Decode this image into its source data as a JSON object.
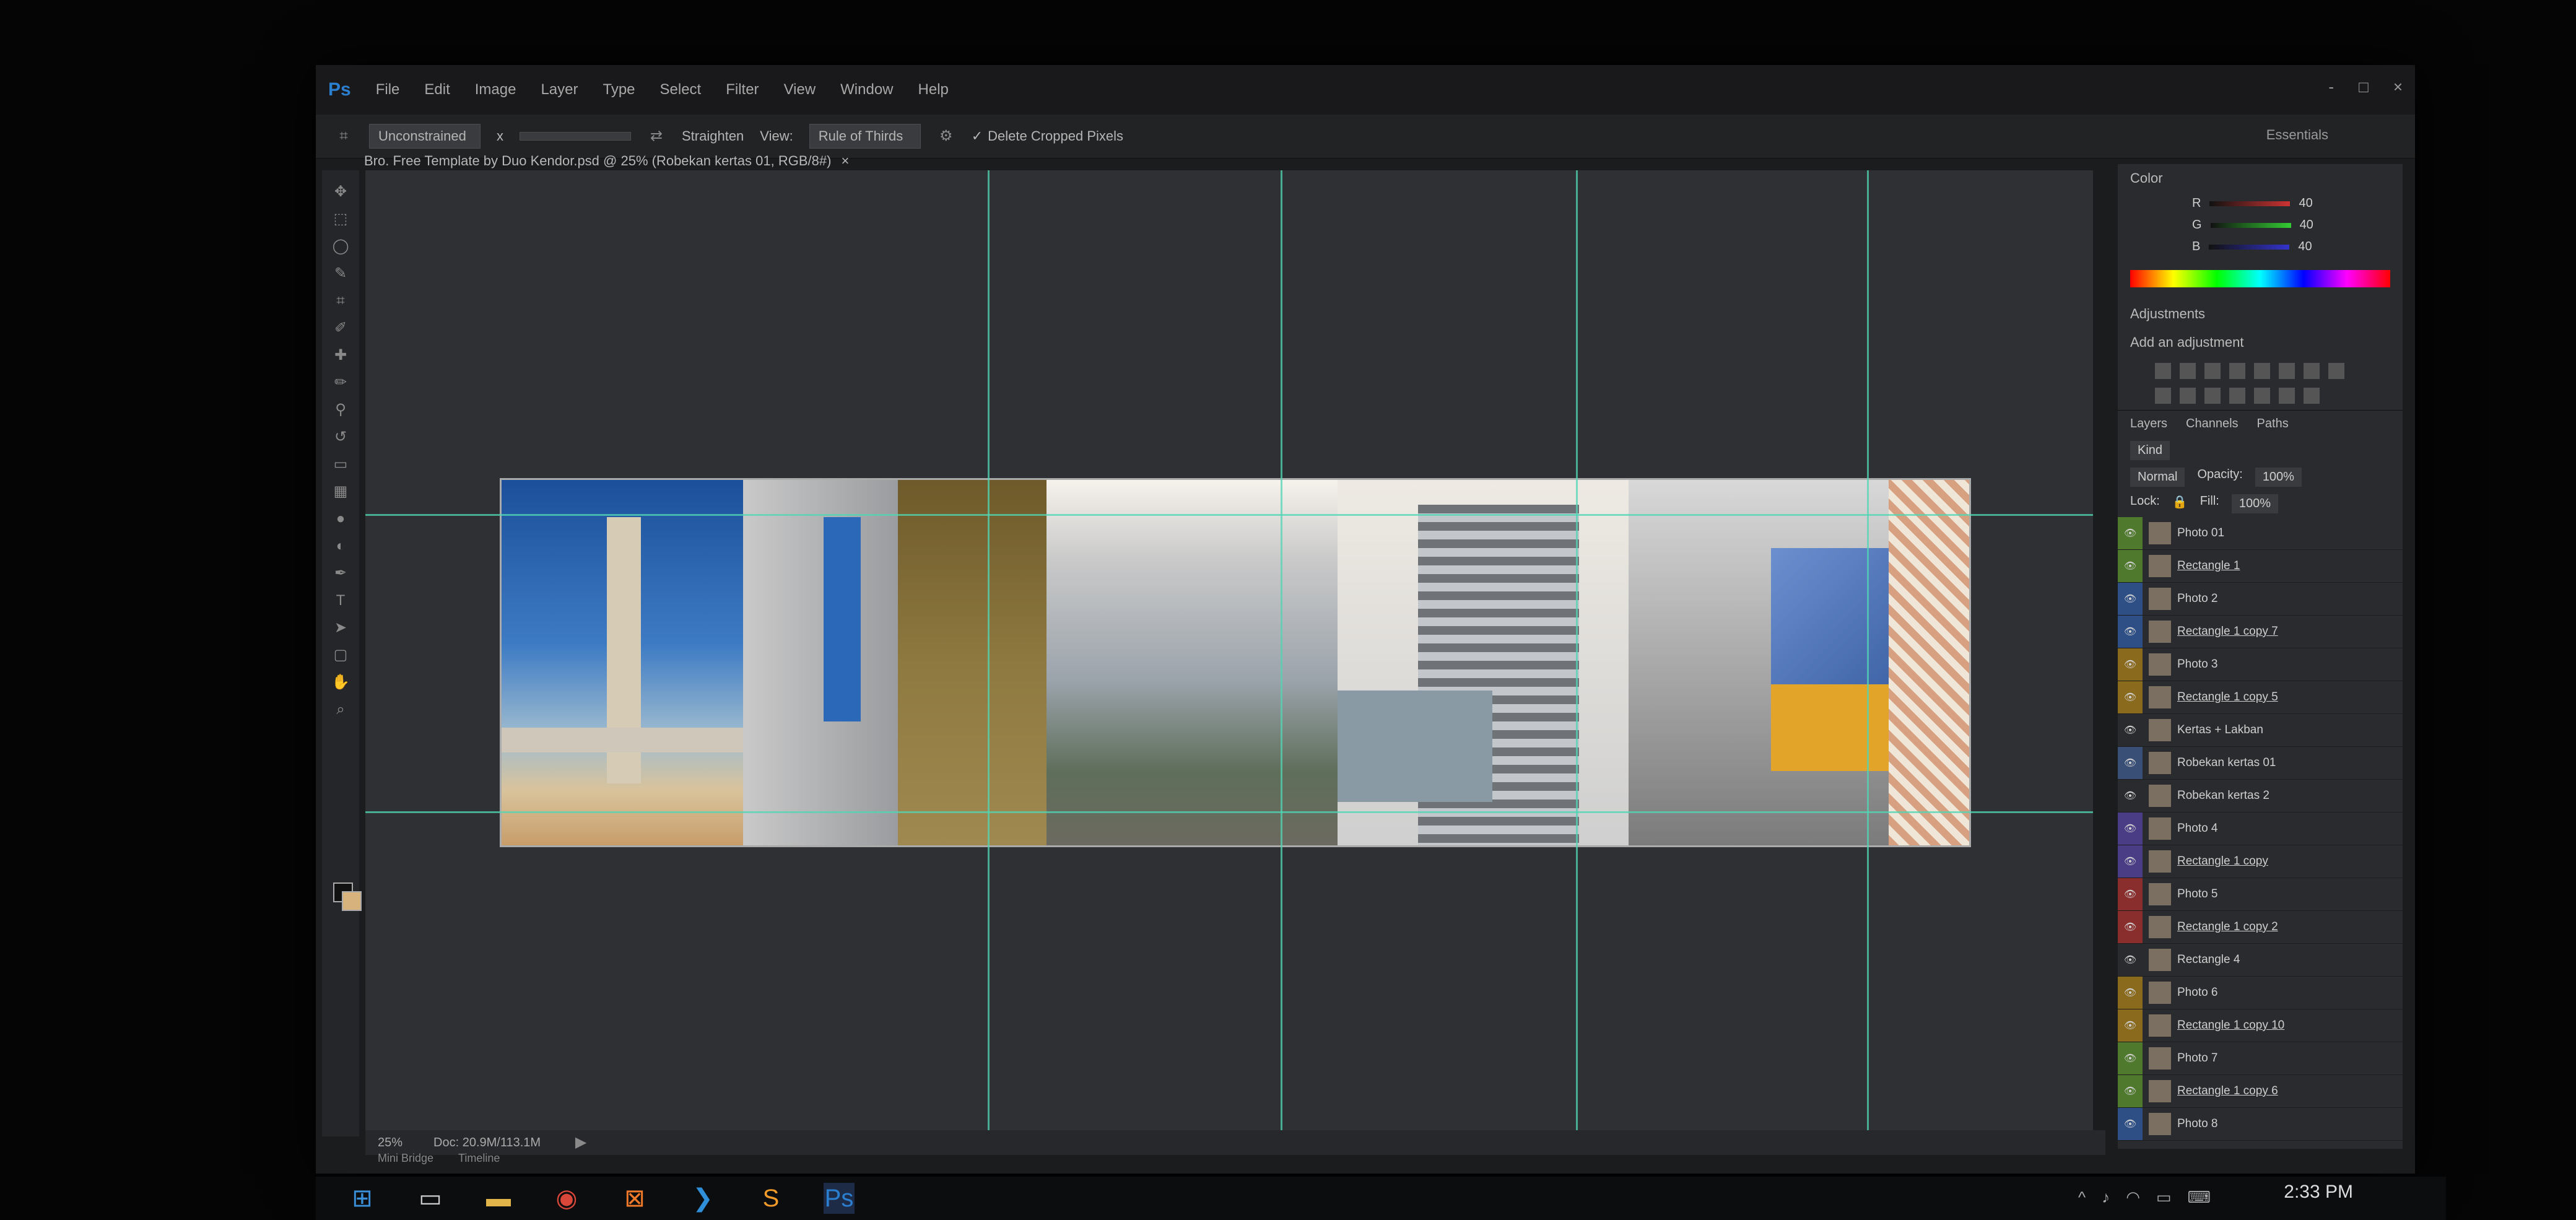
{
  "app": {
    "name": "Ps"
  },
  "menu": [
    "File",
    "Edit",
    "Image",
    "Layer",
    "Type",
    "Select",
    "Filter",
    "View",
    "Window",
    "Help"
  ],
  "window_controls": {
    "minimize": "-",
    "maximize": "□",
    "close": "×"
  },
  "options_bar": {
    "ratio": "Unconstrained",
    "ratio_sep": "x",
    "straighten": "Straighten",
    "view_label": "View:",
    "overlay": "Rule of Thirds",
    "delete_cropped": "Delete Cropped Pixels"
  },
  "workspace": "Essentials",
  "document": {
    "tab_title": "Bro. Free Template by Duo Kendor.psd @ 25% (Robekan kertas 01, RGB/8#)",
    "close": "×"
  },
  "status_bar": {
    "zoom": "25%",
    "doc_size": "Doc: 20.9M/113.1M"
  },
  "bottom_tabs": [
    "Mini Bridge",
    "Timeline"
  ],
  "color_panel": {
    "title": "Color",
    "rows": [
      {
        "channel": "R",
        "value": "40"
      },
      {
        "channel": "G",
        "value": "40"
      },
      {
        "channel": "B",
        "value": "40"
      }
    ]
  },
  "adjustments": {
    "title": "Adjustments",
    "subtitle": "Add an adjustment"
  },
  "layers_panel": {
    "tabs": [
      "Layers",
      "Channels",
      "Paths"
    ],
    "kind": "Kind",
    "blend_mode": "Normal",
    "opacity_label": "Opacity:",
    "opacity": "100%",
    "lock_label": "Lock:",
    "fill_label": "Fill:",
    "fill": "100%",
    "layers": [
      {
        "name": "Photo 01",
        "color": "#4f7a2d",
        "underline": false
      },
      {
        "name": "Rectangle 1",
        "color": "#4f7a2d",
        "underline": true
      },
      {
        "name": "Photo 2",
        "color": "#2d4f86",
        "underline": false
      },
      {
        "name": "Rectangle 1 copy 7",
        "color": "#2d4f86",
        "underline": true
      },
      {
        "name": "Photo 3",
        "color": "#8a6a1d",
        "underline": false
      },
      {
        "name": "Rectangle 1 copy 5",
        "color": "#8a6a1d",
        "underline": true
      },
      {
        "name": "Kertas + Lakban",
        "color": "#2a2b2e",
        "underline": false
      },
      {
        "name": "Robekan kertas 01",
        "color": "#3a4f75",
        "underline": false
      },
      {
        "name": "Robekan kertas 2",
        "color": "#2a2b2e",
        "underline": false
      },
      {
        "name": "Photo 4",
        "color": "#4a3d86",
        "underline": false
      },
      {
        "name": "Rectangle 1 copy",
        "color": "#4a3d86",
        "underline": true
      },
      {
        "name": "Photo 5",
        "color": "#8a2d2d",
        "underline": false
      },
      {
        "name": "Rectangle 1 copy 2",
        "color": "#8a2d2d",
        "underline": true
      },
      {
        "name": "Rectangle 4",
        "color": "#2a2b2e",
        "underline": false
      },
      {
        "name": "Photo 6",
        "color": "#8a6a1d",
        "underline": false
      },
      {
        "name": "Rectangle 1 copy 10",
        "color": "#8a6a1d",
        "underline": true
      },
      {
        "name": "Photo 7",
        "color": "#4f7a2d",
        "underline": false
      },
      {
        "name": "Rectangle 1 copy 6",
        "color": "#4f7a2d",
        "underline": true
      },
      {
        "name": "Photo 8",
        "color": "#2d4f86",
        "underline": false
      }
    ]
  },
  "taskbar": {
    "time": "2:33 PM"
  }
}
